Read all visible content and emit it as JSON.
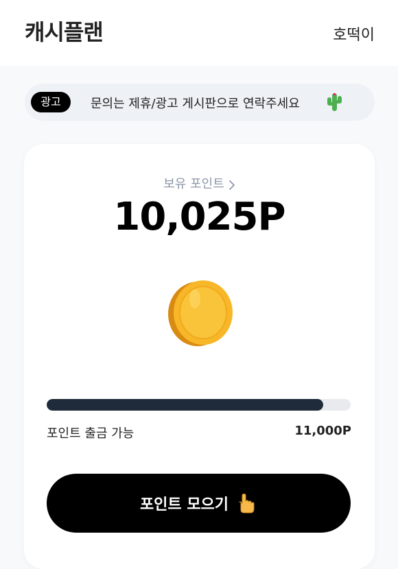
{
  "header": {
    "title": "캐시플랜",
    "user_name": "호떡이"
  },
  "ad": {
    "badge": "광고",
    "text": "문의는 제휴/광고 게시판으로 연락주세요",
    "icon": "cactus-icon"
  },
  "points": {
    "label": "보유 포인트",
    "value": "10,025P",
    "progress": 0.91,
    "withdraw_label": "포인트 출금 가능",
    "withdraw_amount": "11,000P"
  },
  "actions": {
    "collect_label": "포인트 모으기"
  },
  "colors": {
    "accent": "#000000",
    "progress_fill": "#1f2b3a",
    "progress_track": "#e8eaee",
    "coin": "#f7b728",
    "label_gray": "#8d97a8"
  }
}
